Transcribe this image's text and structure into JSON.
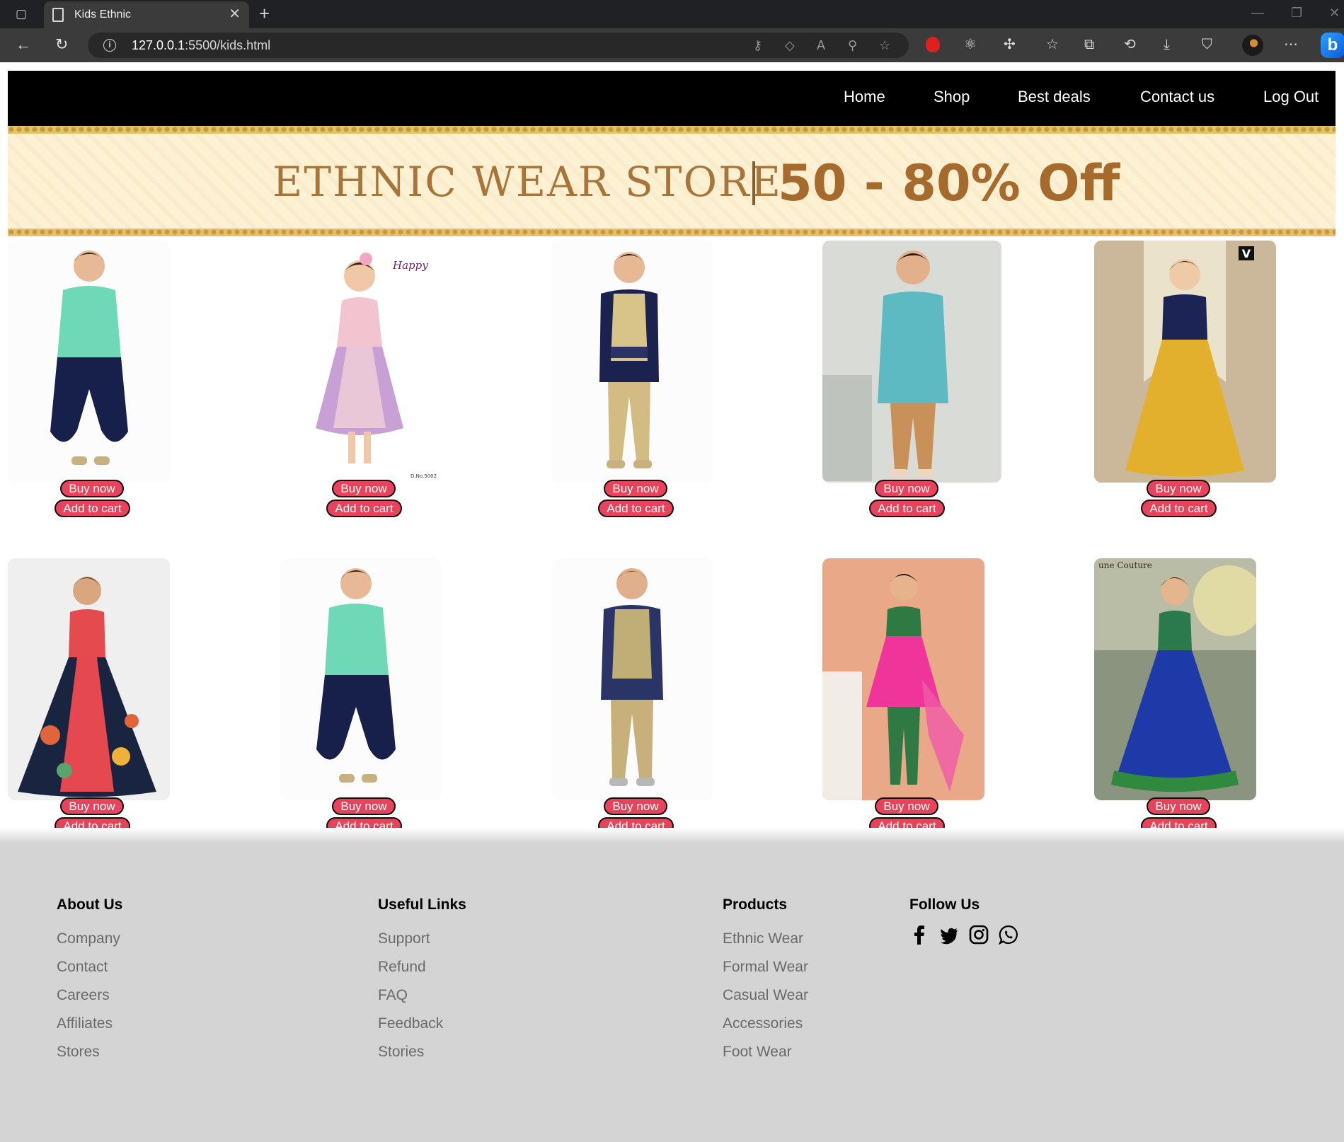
{
  "browser": {
    "tab_title": "Kids Ethnic",
    "url_host": "127.0.0.1",
    "url_path": ":5500/kids.html"
  },
  "nav": {
    "items": [
      "Home",
      "Shop",
      "Best deals",
      "Contact us",
      "Log Out"
    ]
  },
  "banner": {
    "title": "ETHNIC WEAR STORE",
    "offer": "50 - 80% Off"
  },
  "products": {
    "buy_label": "Buy now",
    "cart_label": "Add to cart",
    "row1": [
      {
        "name": "Mint sherwani with navy dhoti"
      },
      {
        "name": "Pink lehenga dress",
        "brand_mark": "Happy",
        "code": "D.No.5002"
      },
      {
        "name": "Gold jacket with navy kurta"
      },
      {
        "name": "Aqua sherwani"
      },
      {
        "name": "Mustard lehenga with navy choli",
        "brand_mark": "V"
      }
    ],
    "row2": [
      {
        "name": "Floral gown"
      },
      {
        "name": "Mint sherwani with navy dhoti"
      },
      {
        "name": "Striped jacket with kurta"
      },
      {
        "name": "Pink anarkali suit"
      },
      {
        "name": "Blue lehenga",
        "brand_mark": "une Couture"
      }
    ]
  },
  "footer": {
    "about": {
      "heading": "About Us",
      "links": [
        "Company",
        "Contact",
        "Careers",
        "Affiliates",
        "Stores"
      ]
    },
    "useful": {
      "heading": "Useful Links",
      "links": [
        "Support",
        "Refund",
        "FAQ",
        "Feedback",
        "Stories"
      ]
    },
    "products": {
      "heading": "Products",
      "links": [
        "Ethnic Wear",
        "Formal Wear",
        "Casual Wear",
        "Accessories",
        "Foot Wear"
      ]
    },
    "follow": {
      "heading": "Follow Us",
      "icons": [
        "facebook-icon",
        "twitter-icon",
        "instagram-icon",
        "whatsapp-icon"
      ]
    }
  }
}
